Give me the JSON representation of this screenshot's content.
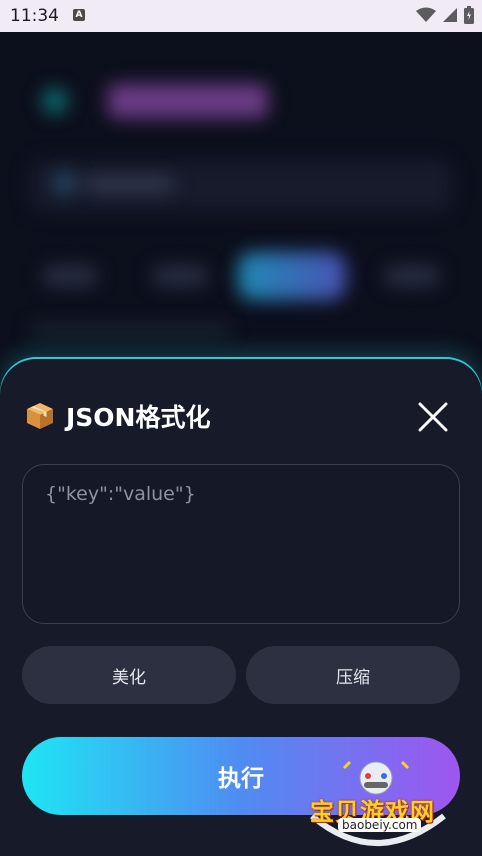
{
  "status_bar": {
    "time": "11:34",
    "notification_icon": "a-letter-icon",
    "right_icons": [
      "wifi-icon",
      "signal-icon",
      "battery-icon"
    ]
  },
  "sheet": {
    "title_icon": "package-icon",
    "title": "JSON格式化",
    "close_icon": "close-icon",
    "input": {
      "value": "",
      "placeholder": "{\"key\":\"value\"}"
    },
    "buttons": {
      "beautify": "美化",
      "compress": "压缩",
      "execute": "执行"
    }
  },
  "colors": {
    "accent_start": "#1ee5f4",
    "accent_end": "#9e56ef",
    "sheet_border": "#2fc8d5",
    "sheet_bg": "#171a29"
  },
  "watermark": {
    "text": "宝贝游戏网",
    "url": "baobeiy.com"
  }
}
